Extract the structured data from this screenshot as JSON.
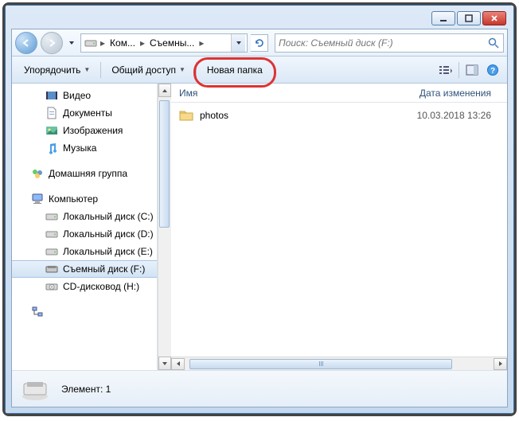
{
  "breadcrumb": {
    "seg1": "Ком...",
    "seg2": "Съемны..."
  },
  "search": {
    "placeholder": "Поиск: Съемный диск (F:)"
  },
  "toolbar": {
    "organize": "Упорядочить",
    "share": "Общий доступ",
    "newfolder": "Новая папка"
  },
  "columns": {
    "name": "Имя",
    "date": "Дата изменения"
  },
  "files": [
    {
      "name": "photos",
      "date": "10.03.2018 13:26"
    }
  ],
  "sidebar": {
    "videos": "Видео",
    "documents": "Документы",
    "pictures": "Изображения",
    "music": "Музыка",
    "homegroup": "Домашняя группа",
    "computer": "Компьютер",
    "drive_c": "Локальный диск (C:)",
    "drive_d": "Локальный диск (D:)",
    "drive_e": "Локальный диск (E:)",
    "drive_f": "Съемный диск (F:)",
    "drive_h": "CD-дисковод (H:)"
  },
  "status": {
    "text": "Элемент: 1"
  },
  "highlight_target": "new-folder-button"
}
